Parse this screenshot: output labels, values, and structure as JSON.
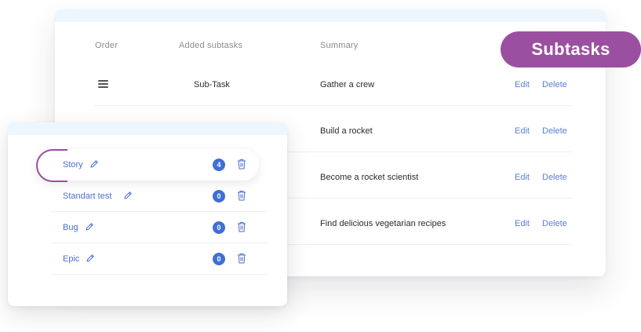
{
  "table": {
    "headers": {
      "order": "Order",
      "added_subtasks": "Added subtasks",
      "summary": "Summary"
    },
    "rows": [
      {
        "subtask": "Sub-Task",
        "summary": "Gather a crew",
        "edit": "Edit",
        "delete": "Delete"
      },
      {
        "subtask": "",
        "summary": "Build a rocket",
        "edit": "Edit",
        "delete": "Delete"
      },
      {
        "subtask": "",
        "summary": "Become a rocket scientist",
        "edit": "Edit",
        "delete": "Delete"
      },
      {
        "subtask": "",
        "summary": "Find delicious vegetarian recipes",
        "edit": "Edit",
        "delete": "Delete"
      }
    ]
  },
  "pill": {
    "label": "Subtasks",
    "color": "#9b4fa0"
  },
  "issue_types": [
    {
      "name": "Story",
      "count": "4",
      "active": true
    },
    {
      "name": "Standart test",
      "count": "0",
      "active": false
    },
    {
      "name": "Bug",
      "count": "0",
      "active": false
    },
    {
      "name": "Epic",
      "count": "0",
      "active": false
    }
  ],
  "colors": {
    "link": "#5b7fd6",
    "badge": "#3f6fd6",
    "topbar": "#eef6fd",
    "accent": "#9b4fa0"
  },
  "icons": {
    "drag": "drag-handle-icon",
    "edit": "pencil-icon",
    "delete": "trash-icon"
  }
}
